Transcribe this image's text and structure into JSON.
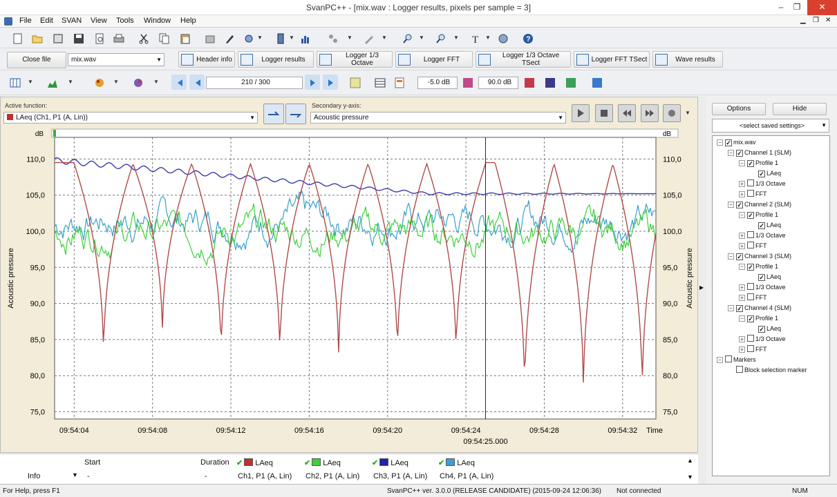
{
  "window": {
    "title": "SvanPC++ - [mix.wav : Logger results, pixels per sample = 3]",
    "minimize": "–",
    "maximize": "❐",
    "close": "✕"
  },
  "menu": [
    "File",
    "Edit",
    "SVAN",
    "View",
    "Tools",
    "Window",
    "Help"
  ],
  "toolbar2": {
    "close_file": "Close file",
    "file_select": "mix.wav",
    "tabs": [
      "Header info",
      "Logger results",
      "Logger 1/3 Octave",
      "Logger FFT",
      "Logger 1/3 Octave TSect",
      "Logger FFT TSect",
      "Wave results"
    ]
  },
  "toolbar3": {
    "position": "210 / 300",
    "db_low": "-5.0 dB",
    "db_high": "90.0 dB"
  },
  "chart_panel": {
    "active_function_label": "Active function:",
    "active_function_value": "LAeq (Ch1, P1 (A, Lin))",
    "secondary_label": "Secondary y-axis:",
    "secondary_value": "Acoustic pressure"
  },
  "chart_data": {
    "type": "line",
    "ylabel_left": "Acoustic pressure",
    "ylabel_right": "Acoustic pressure",
    "unit": "dB",
    "yticks": [
      "110,0",
      "105,0",
      "100,0",
      "95,0",
      "90,0",
      "85,0",
      "80,0",
      "75,0"
    ],
    "ylim": [
      74,
      113
    ],
    "xticks": [
      "09:54:04",
      "09:54:08",
      "09:54:12",
      "09:54:16",
      "09:54:20",
      "09:54:24",
      "09:54:28",
      "09:54:32"
    ],
    "xlabel": "Time",
    "cursor_label": "09:54:25.000",
    "grid": true,
    "series": [
      {
        "name": "Ch1, P1 (A, Lin)",
        "color": "#b04a4a",
        "minima_x": [
          "09:54:05.5",
          "09:54:08.5",
          "09:54:11.5",
          "09:54:14.5",
          "09:54:17.5",
          "09:54:20.5",
          "09:54:23.5",
          "09:54:27.0",
          "09:54:30.0",
          "09:54:33.0"
        ],
        "minima_y": [
          81.5,
          84.8,
          81.5,
          81.5,
          81.5,
          81.5,
          81.5,
          76.3,
          76.5,
          76.3
        ],
        "peak_y": 109.5
      },
      {
        "name": "Ch2, P1 (A, Lin)",
        "color": "#3fcf3f",
        "range": [
          92,
          106
        ]
      },
      {
        "name": "Ch3, P1 (A, Lin)",
        "color": "#3a3aa8",
        "start": 109.8,
        "end": 105.2
      },
      {
        "name": "Ch4, P1 (A, Lin)",
        "color": "#3a9fc8",
        "range": [
          94,
          107
        ]
      }
    ]
  },
  "legend": {
    "start": "Start",
    "duration": "Duration",
    "info": "Info",
    "dash1": "-",
    "dash2": "-",
    "items": [
      {
        "label": "LAeq",
        "channel": "Ch1, P1 (A, Lin)",
        "color": "#c0302e"
      },
      {
        "label": "LAeq",
        "channel": "Ch2, P1 (A, Lin)",
        "color": "#3fcf3f"
      },
      {
        "label": "LAeq",
        "channel": "Ch3, P1 (A, Lin)",
        "color": "#2222aa"
      },
      {
        "label": "LAeq",
        "channel": "Ch4, P1 (A, Lin)",
        "color": "#3a9fd8"
      }
    ]
  },
  "right_panel": {
    "options": "Options",
    "hide": "Hide",
    "saved_settings": "<select saved settings>",
    "tree": [
      "mix.wav",
      "Channel 1 (SLM)",
      "Profile 1",
      "LAeq",
      "1/3 Octave",
      "FFT",
      "Channel 2 (SLM)",
      "Profile 1",
      "LAeq",
      "1/3 Octave",
      "FFT",
      "Channel 3 (SLM)",
      "Profile 1",
      "LAeq",
      "1/3 Octave",
      "FFT",
      "Channel 4 (SLM)",
      "Profile 1",
      "LAeq",
      "1/3 Octave",
      "FFT",
      "Markers",
      "Block selection marker"
    ]
  },
  "status": {
    "help": "For Help, press F1",
    "version": "SvanPC++ ver. 3.0.0 (RELEASE CANDIDATE) (2015-09-24 12:06:36)",
    "connection": "Not connected",
    "num": "NUM"
  }
}
